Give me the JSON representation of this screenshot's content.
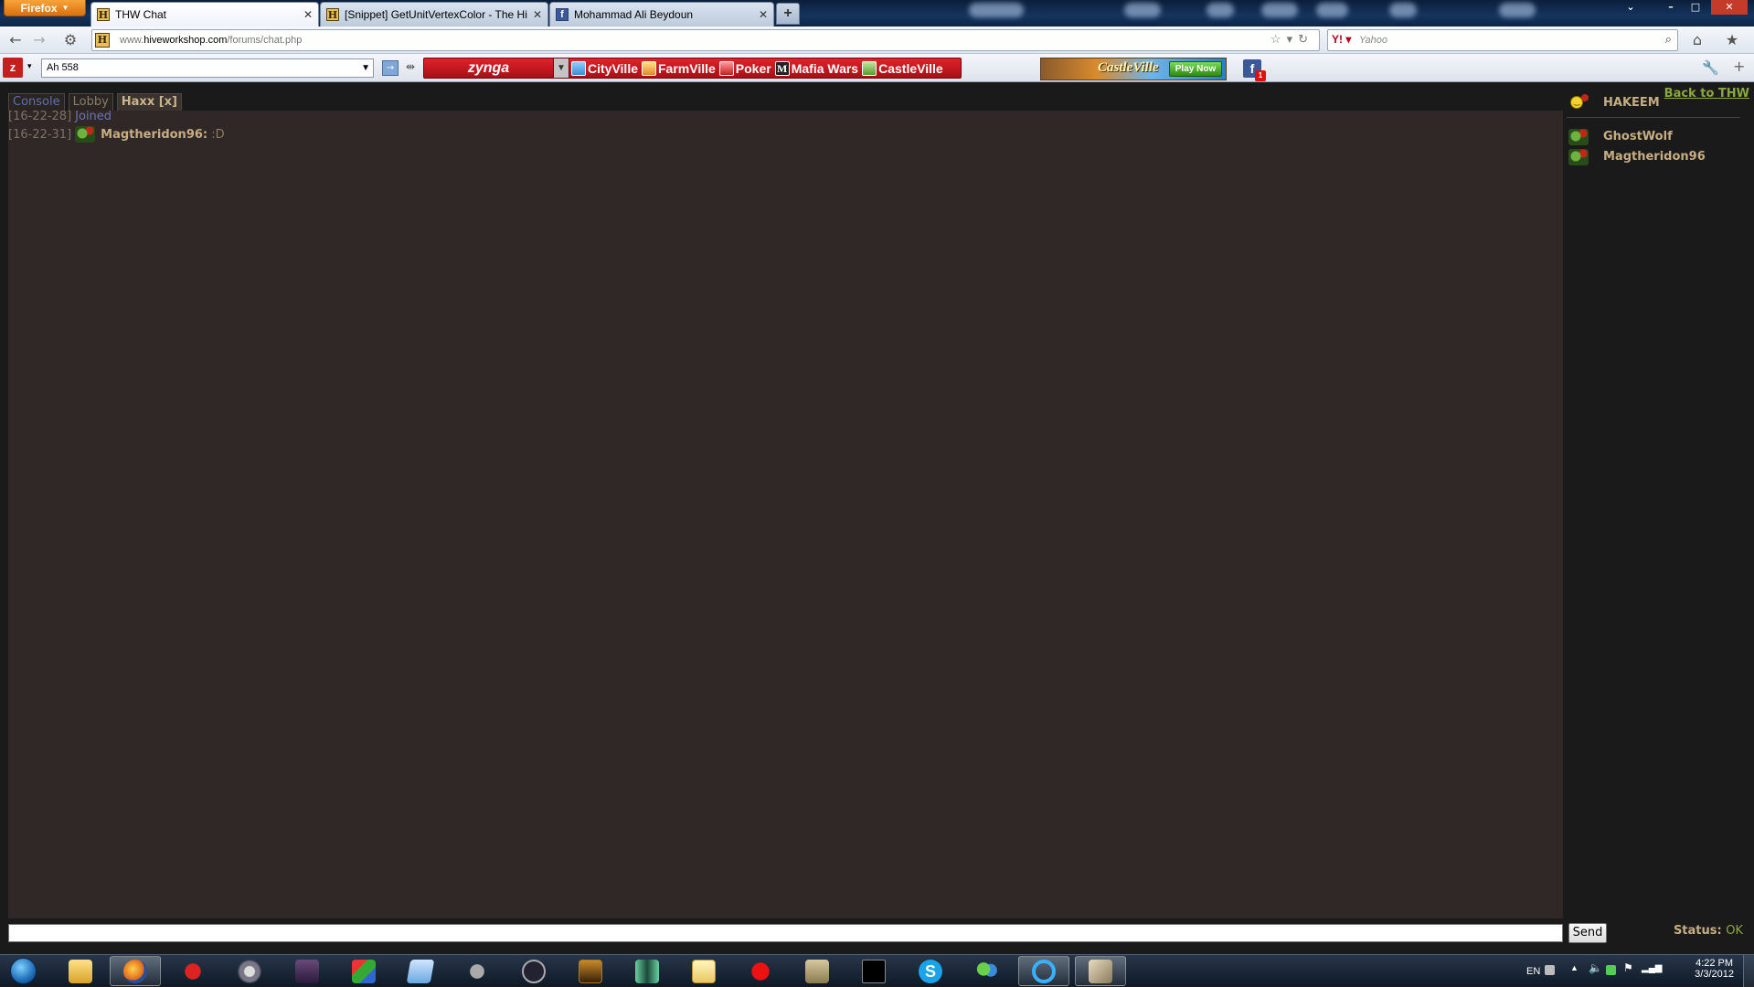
{
  "browser": {
    "menu_label": "Firefox",
    "tabs": [
      {
        "label": "THW Chat",
        "active": true
      },
      {
        "label": "[Snippet] GetUnitVertexColor - The Hi...",
        "active": false
      },
      {
        "label": "Mohammad Ali Beydoun",
        "active": false
      }
    ],
    "url_prefix": "www.",
    "url_domain": "hiveworkshop.com",
    "url_path": "/forums/chat.php",
    "search_placeholder": "Yahoo"
  },
  "zynga_toolbar": {
    "search_value": "Ah 558",
    "brand": "zynga",
    "games": [
      "CityVille",
      "FarmVille",
      "Poker",
      "Mafia Wars",
      "CastleVille"
    ],
    "ad_title": "CastleVille",
    "ad_button": "Play Now",
    "notification_count": "1"
  },
  "chat": {
    "back_link": "Back to THW",
    "tabs": [
      "Console",
      "Lobby",
      "Haxx [x]"
    ],
    "messages": [
      {
        "time": "[16-22-28]",
        "system": "Joined"
      },
      {
        "time": "[16-22-31]",
        "user": "Magtheridon96:",
        "text": ":D"
      }
    ],
    "users": {
      "self": "HAKEEM",
      "others": [
        "GhostWolf",
        "Magtheridon96"
      ]
    },
    "send_label": "Send",
    "status_label": "Status:",
    "status_value": "OK"
  },
  "taskbar": {
    "language": "EN",
    "time": "4:22 PM",
    "date": "3/3/2012"
  }
}
